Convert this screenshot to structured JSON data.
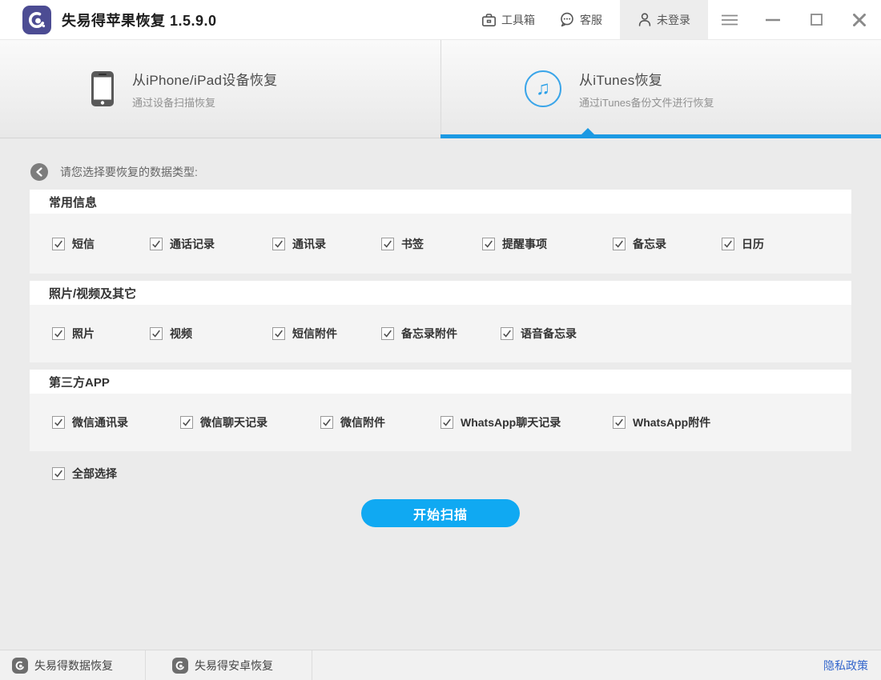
{
  "titlebar": {
    "app_title": "失易得苹果恢复  1.5.9.0",
    "toolbox_label": "工具箱",
    "service_label": "客服",
    "login_label": "未登录"
  },
  "tabs": [
    {
      "title": "从iPhone/iPad设备恢复",
      "subtitle": "通过设备扫描恢复",
      "active": false
    },
    {
      "title": "从iTunes恢复",
      "subtitle": "通过iTunes备份文件进行恢复",
      "active": true
    }
  ],
  "content": {
    "prompt": "请您选择要恢复的数据类型:",
    "sections": [
      {
        "title": "常用信息",
        "items": [
          {
            "label": "短信",
            "checked": true
          },
          {
            "label": "通话记录",
            "checked": true
          },
          {
            "label": "通讯录",
            "checked": true
          },
          {
            "label": "书签",
            "checked": true
          },
          {
            "label": "提醒事项",
            "checked": true
          },
          {
            "label": "备忘录",
            "checked": true
          },
          {
            "label": "日历",
            "checked": true
          }
        ]
      },
      {
        "title": "照片/视频及其它",
        "items": [
          {
            "label": "照片",
            "checked": true
          },
          {
            "label": "视频",
            "checked": true
          },
          {
            "label": "短信附件",
            "checked": true
          },
          {
            "label": "备忘录附件",
            "checked": true
          },
          {
            "label": "语音备忘录",
            "checked": true
          }
        ]
      },
      {
        "title": "第三方APP",
        "items": [
          {
            "label": "微信通讯录",
            "checked": true
          },
          {
            "label": "微信聊天记录",
            "checked": true
          },
          {
            "label": "微信附件",
            "checked": true
          },
          {
            "label": "WhatsApp聊天记录",
            "checked": true
          },
          {
            "label": "WhatsApp附件",
            "checked": true
          }
        ]
      }
    ],
    "select_all": {
      "label": "全部选择",
      "checked": true
    },
    "scan_button_label": "开始扫描"
  },
  "footer": {
    "links": [
      {
        "label": "失易得数据恢复"
      },
      {
        "label": "失易得安卓恢复"
      }
    ],
    "privacy_label": "隐私政策"
  },
  "icons": {
    "music_note_glyph": "♫"
  },
  "colors": {
    "accent_button_blue": "#10a9f2",
    "active_tab_underline": "#1b99e3",
    "icon_circle_blue": "#3aa5e9",
    "logo_indigo": "#4c4c93",
    "privacy_link_blue": "#3366cc"
  }
}
